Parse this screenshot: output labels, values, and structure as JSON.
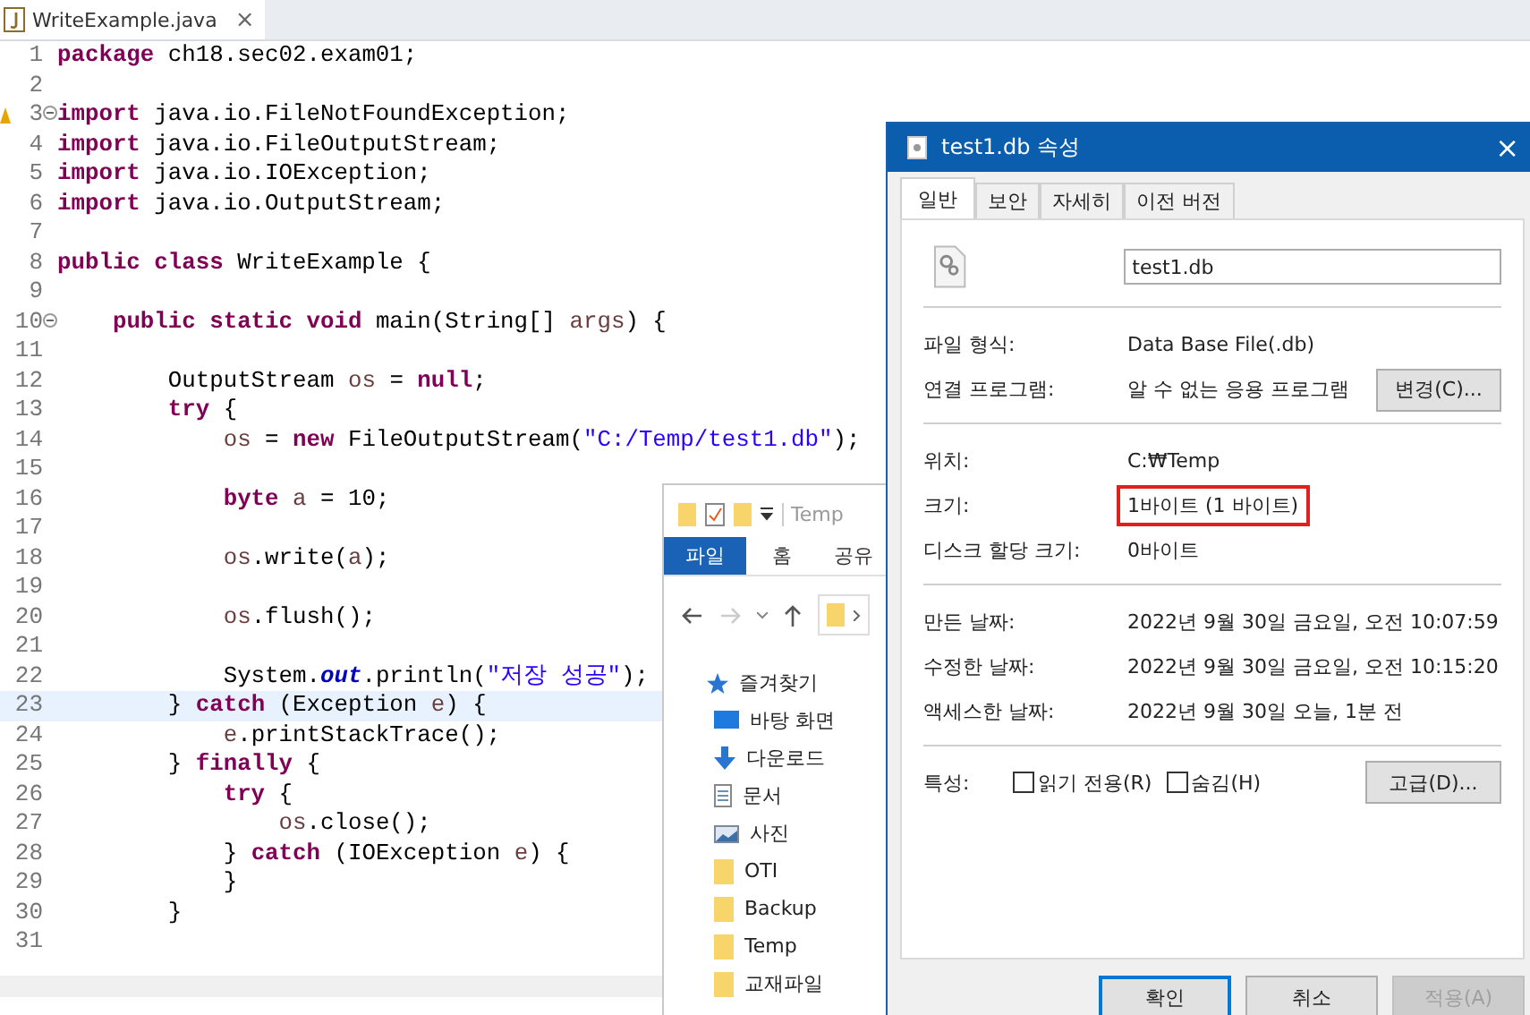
{
  "editor": {
    "tab": {
      "title": "WriteExample.java",
      "close": "×"
    },
    "lines": [
      {
        "number": "1",
        "tokens": [
          {
            "kind": "kw",
            "text": "package"
          },
          {
            "kind": "plain",
            "text": " ch18.sec02.exam01;"
          }
        ]
      },
      {
        "number": "2"
      },
      {
        "number": "3",
        "fold": true,
        "warning": true,
        "tokens": [
          {
            "kind": "kw",
            "text": "import"
          },
          {
            "kind": "plain",
            "text": " java.io.FileNotFoundException;"
          }
        ]
      },
      {
        "number": "4",
        "tokens": [
          {
            "kind": "kw",
            "text": "import"
          },
          {
            "kind": "plain",
            "text": " java.io.FileOutputStream;"
          }
        ]
      },
      {
        "number": "5",
        "tokens": [
          {
            "kind": "kw",
            "text": "import"
          },
          {
            "kind": "plain",
            "text": " java.io.IOException;"
          }
        ]
      },
      {
        "number": "6",
        "tokens": [
          {
            "kind": "kw",
            "text": "import"
          },
          {
            "kind": "plain",
            "text": " java.io.OutputStream;"
          }
        ]
      },
      {
        "number": "7"
      },
      {
        "number": "8",
        "tokens": [
          {
            "kind": "kw",
            "text": "public class"
          },
          {
            "kind": "plain",
            "text": " WriteExample {"
          }
        ]
      },
      {
        "number": "9"
      },
      {
        "number": "10",
        "fold": true,
        "tokens": [
          {
            "kind": "kw",
            "text": "\tpublic static void"
          },
          {
            "kind": "plain",
            "text": " main(String[] "
          },
          {
            "kind": "var",
            "text": "args"
          },
          {
            "kind": "plain",
            "text": ") {"
          }
        ]
      },
      {
        "number": "11"
      },
      {
        "number": "12",
        "tokens": [
          {
            "kind": "plain",
            "text": "\t\tOutputStream "
          },
          {
            "kind": "var",
            "text": "os"
          },
          {
            "kind": "plain",
            "text": " = "
          },
          {
            "kind": "kw",
            "text": "null"
          },
          {
            "kind": "plain",
            "text": ";"
          }
        ]
      },
      {
        "number": "13",
        "tokens": [
          {
            "kind": "kw",
            "text": "\t\ttry"
          },
          {
            "kind": "plain",
            "text": " {"
          }
        ]
      },
      {
        "number": "14",
        "tokens": [
          {
            "kind": "var",
            "text": "\t\t\tos"
          },
          {
            "kind": "plain",
            "text": " = "
          },
          {
            "kind": "kw",
            "text": "new"
          },
          {
            "kind": "plain",
            "text": " FileOutputStream("
          },
          {
            "kind": "str",
            "text": "\"C:/Temp/test1.db\""
          },
          {
            "kind": "plain",
            "text": ");"
          }
        ]
      },
      {
        "number": "15"
      },
      {
        "number": "16",
        "tokens": [
          {
            "kind": "kw",
            "text": "\t\t\tbyte "
          },
          {
            "kind": "var",
            "text": "a"
          },
          {
            "kind": "plain",
            "text": " = 10;"
          }
        ]
      },
      {
        "number": "17"
      },
      {
        "number": "18",
        "tokens": [
          {
            "kind": "var",
            "text": "\t\t\tos"
          },
          {
            "kind": "plain",
            "text": ".write("
          },
          {
            "kind": "var",
            "text": "a"
          },
          {
            "kind": "plain",
            "text": ");"
          }
        ]
      },
      {
        "number": "19"
      },
      {
        "number": "20",
        "tokens": [
          {
            "kind": "var",
            "text": "\t\t\tos"
          },
          {
            "kind": "plain",
            "text": ".flush();"
          }
        ]
      },
      {
        "number": "21"
      },
      {
        "number": "22",
        "tokens": [
          {
            "kind": "plain",
            "text": "\t\t\tSystem."
          },
          {
            "kind": "field",
            "text": "out"
          },
          {
            "kind": "plain",
            "text": ".println("
          },
          {
            "kind": "str",
            "text": "\"저장 성공\""
          },
          {
            "kind": "plain",
            "text": ");"
          }
        ]
      },
      {
        "number": "23",
        "highlighted": true,
        "tokens": [
          {
            "kind": "plain",
            "text": "\t\t} "
          },
          {
            "kind": "kw",
            "text": "catch"
          },
          {
            "kind": "plain",
            "text": " (Exception "
          },
          {
            "kind": "var",
            "text": "e"
          },
          {
            "kind": "plain",
            "text": ") {"
          }
        ]
      },
      {
        "number": "24",
        "tokens": [
          {
            "kind": "var",
            "text": "\t\t\te"
          },
          {
            "kind": "plain",
            "text": ".printStackTrace();"
          }
        ]
      },
      {
        "number": "25",
        "tokens": [
          {
            "kind": "plain",
            "text": "\t\t} "
          },
          {
            "kind": "kw",
            "text": "finally"
          },
          {
            "kind": "plain",
            "text": " {"
          }
        ]
      },
      {
        "number": "26",
        "tokens": [
          {
            "kind": "kw",
            "text": "\t\t\ttry"
          },
          {
            "kind": "plain",
            "text": " {"
          }
        ]
      },
      {
        "number": "27",
        "tokens": [
          {
            "kind": "var",
            "text": "\t\t\t\tos"
          },
          {
            "kind": "plain",
            "text": ".close();"
          }
        ]
      },
      {
        "number": "28",
        "tokens": [
          {
            "kind": "plain",
            "text": "\t\t\t} "
          },
          {
            "kind": "kw",
            "text": "catch"
          },
          {
            "kind": "plain",
            "text": " (IOException "
          },
          {
            "kind": "var",
            "text": "e"
          },
          {
            "kind": "plain",
            "text": ") {"
          }
        ]
      },
      {
        "number": "29",
        "tokens": [
          {
            "kind": "plain",
            "text": "\t\t\t}"
          }
        ]
      },
      {
        "number": "30",
        "tokens": [
          {
            "kind": "plain",
            "text": "\t\t}"
          }
        ]
      },
      {
        "number": "31"
      }
    ]
  },
  "explorer": {
    "title": "Temp",
    "ribbon_tabs": [
      {
        "label": "파일",
        "selected": true
      },
      {
        "label": "홈",
        "selected": false
      },
      {
        "label": "공유",
        "selected": false
      }
    ],
    "nav_items": [
      {
        "kind": "star",
        "label": "즐겨찾기"
      },
      {
        "kind": "desktop",
        "label": "바탕 화면"
      },
      {
        "kind": "download",
        "label": "다운로드"
      },
      {
        "kind": "document",
        "label": "문서"
      },
      {
        "kind": "picture",
        "label": "사진"
      },
      {
        "kind": "folder",
        "label": "OTI"
      },
      {
        "kind": "folder",
        "label": "Backup"
      },
      {
        "kind": "folder",
        "label": "Temp"
      },
      {
        "kind": "folder",
        "label": "교재파일"
      }
    ]
  },
  "dialog": {
    "title": "test1.db 속성",
    "close": "×",
    "tabs": [
      {
        "label": "일반",
        "selected": true
      },
      {
        "label": "보안",
        "selected": false
      },
      {
        "label": "자세히",
        "selected": false
      },
      {
        "label": "이전 버전",
        "selected": false
      }
    ],
    "filename": "test1.db",
    "sections": [
      [
        {
          "label": "파일 형식:",
          "value": "Data Base File(.db)"
        },
        {
          "label": "연결 프로그램:",
          "value": "알 수 없는 응용 프로그램",
          "button": "변경(C)..."
        }
      ],
      [
        {
          "label": "위치:",
          "value": "C:₩Temp"
        },
        {
          "label": "크기:",
          "value": "1바이트 (1 바이트)",
          "highlighted": true
        },
        {
          "label": "디스크 할당 크기:",
          "value": "0바이트"
        }
      ],
      [
        {
          "label": "만든 날짜:",
          "value": "2022년 9월 30일 금요일, 오전 10:07:59"
        },
        {
          "label": "수정한 날짜:",
          "value": "2022년 9월 30일 금요일, 오전 10:15:20"
        },
        {
          "label": "액세스한 날짜:",
          "value": "2022년 9월 30일 오늘, 1분 전"
        }
      ]
    ],
    "attributes": {
      "label": "특성:",
      "checkboxes": [
        {
          "label": "읽기 전용(R)",
          "checked": false
        },
        {
          "label": "숨김(H)",
          "checked": false
        }
      ],
      "button": "고급(D)..."
    },
    "buttons": [
      {
        "label": "확인",
        "default": true,
        "disabled": false
      },
      {
        "label": "취소",
        "default": false,
        "disabled": false
      },
      {
        "label": "적용(A)",
        "default": false,
        "disabled": true
      }
    ]
  }
}
